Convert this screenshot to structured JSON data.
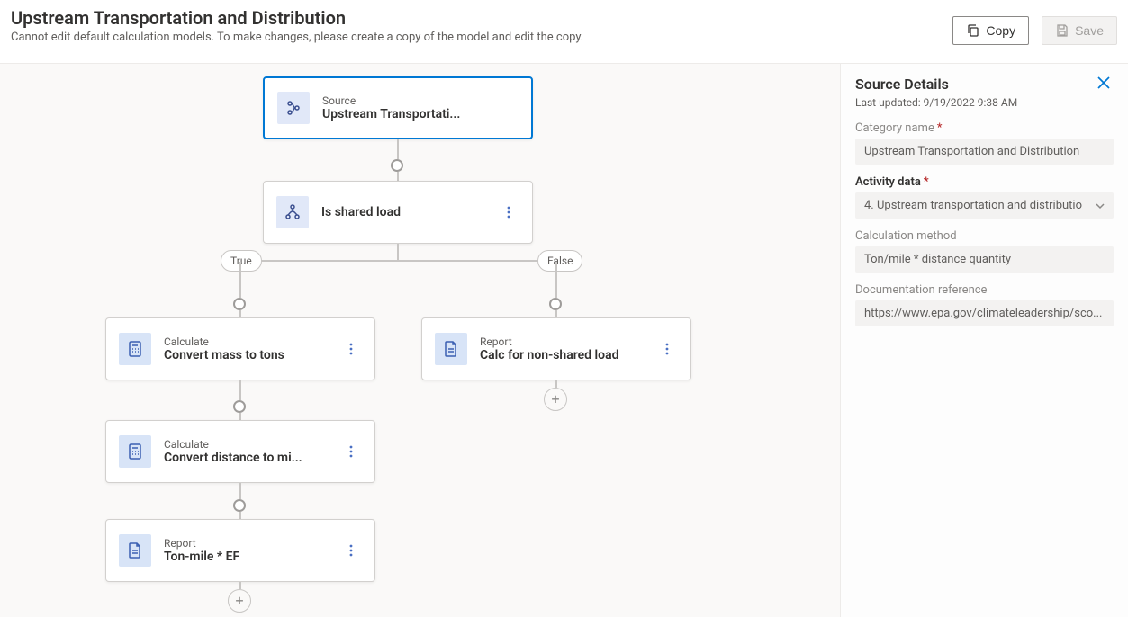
{
  "header": {
    "title": "Upstream Transportation and Distribution",
    "subtitle": "Cannot edit default calculation models. To make changes, please create a copy of the model and edit the copy.",
    "copy_label": "Copy",
    "save_label": "Save"
  },
  "flow": {
    "source": {
      "type": "Source",
      "title": "Upstream Transportati..."
    },
    "branch": {
      "title": "Is shared load"
    },
    "true_label": "True",
    "false_label": "False",
    "calc1": {
      "type": "Calculate",
      "title": "Convert mass to tons"
    },
    "calc2": {
      "type": "Calculate",
      "title": "Convert distance to mi..."
    },
    "report1": {
      "type": "Report",
      "title": "Ton-mile * EF"
    },
    "report_false": {
      "type": "Report",
      "title": "Calc for non-shared load"
    }
  },
  "panel": {
    "title": "Source Details",
    "last_updated": "Last updated: 9/19/2022 9:38 AM",
    "category_label": "Category name",
    "category_value": "Upstream Transportation and Distribution",
    "activity_label": "Activity data",
    "activity_value": "4. Upstream transportation and distributio",
    "method_label": "Calculation method",
    "method_value": "Ton/mile * distance quantity",
    "doc_label": "Documentation reference",
    "doc_value": "https://www.epa.gov/climateleadership/sco..."
  }
}
